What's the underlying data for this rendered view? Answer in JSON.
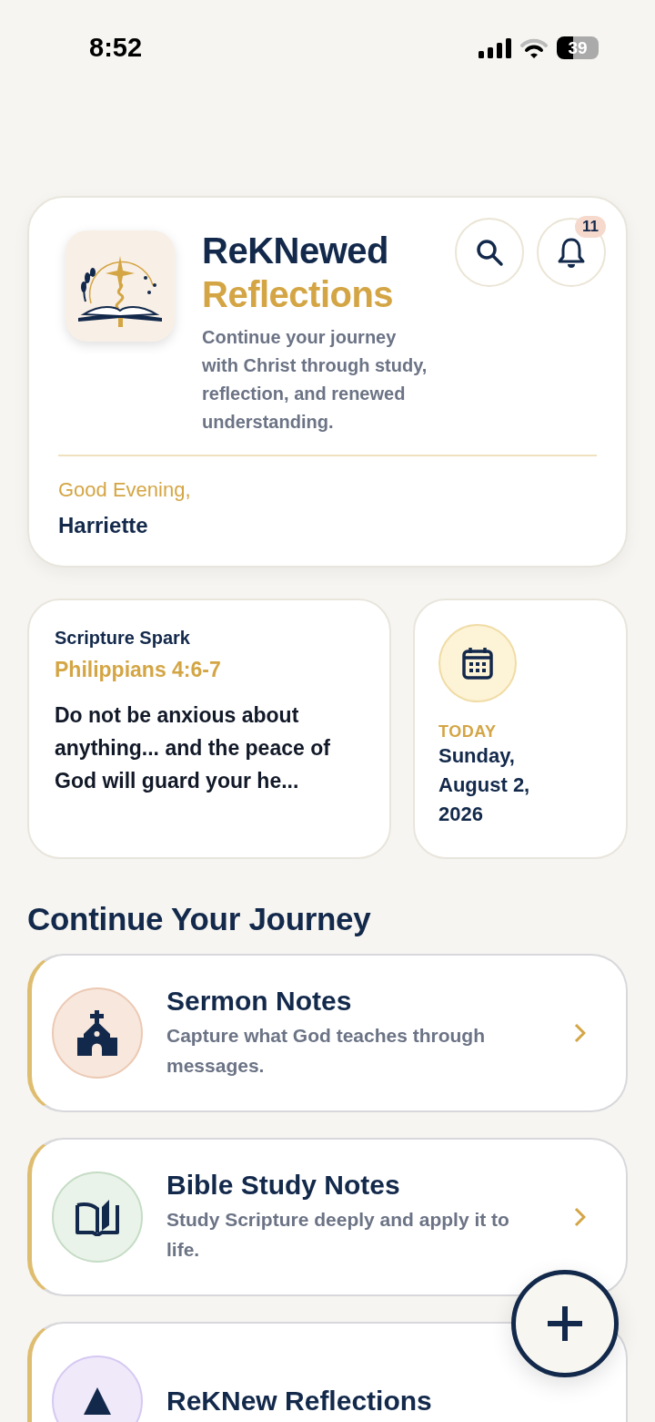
{
  "status_bar": {
    "time": "8:52",
    "battery": "39"
  },
  "header": {
    "title_line_1": "ReKNewed",
    "title_line_2": "Reflections",
    "tagline": "Continue your journey with Christ through study, reflection, and renewed understanding.",
    "notification_count": "11",
    "greeting": "Good Evening,",
    "user_name": "Harriette"
  },
  "scripture_spark": {
    "label": "Scripture Spark",
    "reference": "Philippians 4:6-7",
    "excerpt": "Do not be anxious about anything... and the peace of God will guard your he..."
  },
  "today": {
    "label": "TODAY",
    "date": "Sunday, August 2, 2026"
  },
  "journey": {
    "heading": "Continue Your Journey",
    "items": [
      {
        "kind": "church",
        "color": "#f7e7dc",
        "title": "Sermon Notes",
        "description": "Capture what God teaches through messages."
      },
      {
        "kind": "book",
        "color": "#eaf3ea",
        "title": "Bible Study Notes",
        "description": "Study Scripture deeply and apply it to life."
      },
      {
        "kind": "reflection",
        "color": "#efe9fa",
        "title": "ReKNew Reflections"
      }
    ]
  }
}
